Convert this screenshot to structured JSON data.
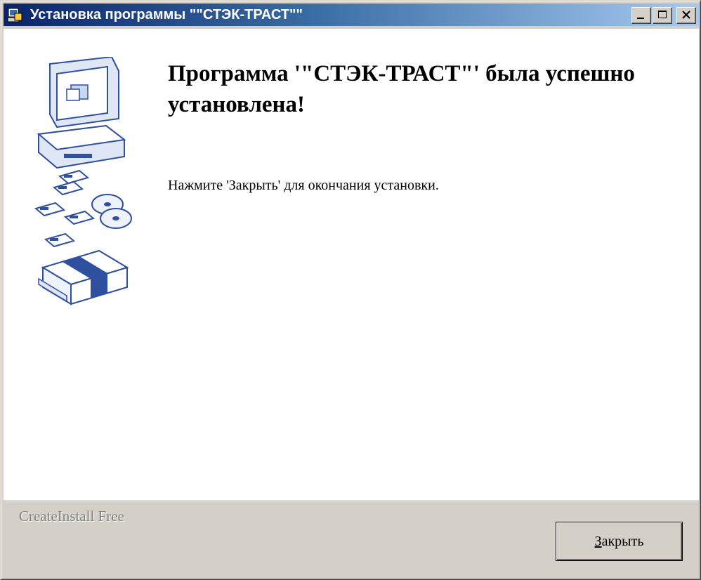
{
  "window": {
    "title": "Установка программы \"\"СТЭК-ТРАСТ\"\"",
    "controls": {
      "minimize_icon": "minimize-icon",
      "maximize_icon": "maximize-icon",
      "close_icon": "close-icon"
    }
  },
  "main": {
    "heading": "Программа '\"СТЭК-ТРАСТ\"' была успешно установлена!",
    "instruction": "Нажмите 'Закрыть' для окончания установки.",
    "illustration_icon": "computer-with-disks-icon"
  },
  "footer": {
    "brand": "CreateInstall Free",
    "close_button": {
      "mnemonic": "З",
      "rest": "акрыть"
    }
  },
  "colors": {
    "titlebar_start": "#0a246a",
    "titlebar_end": "#a6caf0",
    "illustration_blue": "#2f4f9f"
  }
}
